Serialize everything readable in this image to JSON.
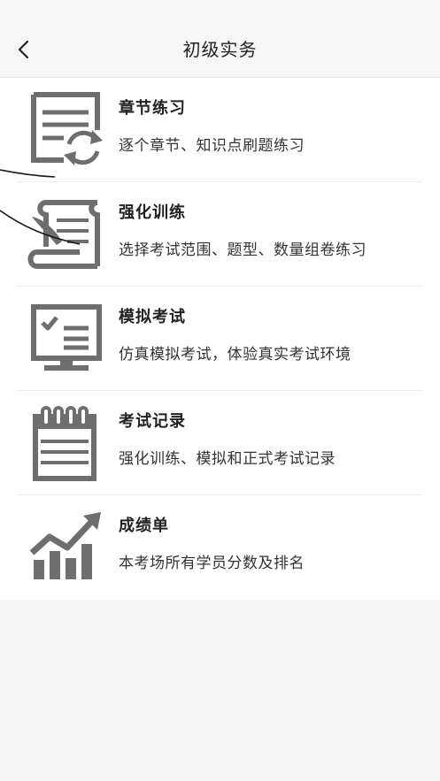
{
  "header": {
    "title": "初级实务"
  },
  "menu": {
    "items": [
      {
        "title": "章节练习",
        "desc": "逐个章节、知识点刷题练习",
        "icon": "chapter-practice-icon"
      },
      {
        "title": "强化训练",
        "desc": "选择考试范围、题型、数量组卷练习",
        "icon": "scroll-quill-icon"
      },
      {
        "title": "模拟考试",
        "desc": "仿真模拟考试，体验真实考试环境",
        "icon": "monitor-checklist-icon"
      },
      {
        "title": "考试记录",
        "desc": "强化训练、模拟和正式考试记录",
        "icon": "calendar-record-icon"
      },
      {
        "title": "成绩单",
        "desc": "本考场所有学员分数及排名",
        "icon": "growth-chart-icon"
      }
    ]
  },
  "colors": {
    "icon": "#6e6e6e",
    "background": "#f5f5f5",
    "card": "#ffffff"
  }
}
